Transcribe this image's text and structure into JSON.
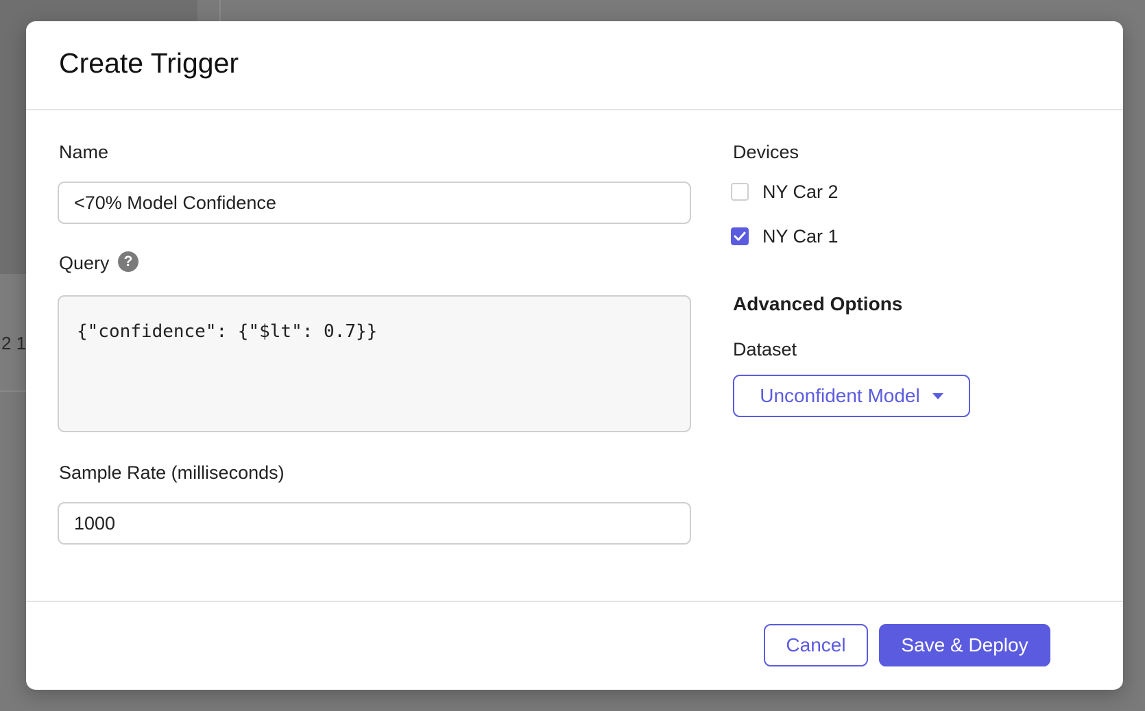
{
  "background": {
    "partial_text": "2 1"
  },
  "modal": {
    "title": "Create Trigger",
    "name_field": {
      "label": "Name",
      "value": "<70% Model Confidence"
    },
    "query_field": {
      "label": "Query",
      "help_glyph": "?",
      "value": "{\"confidence\": {\"$lt\": 0.7}}"
    },
    "sample_rate_field": {
      "label": "Sample Rate (milliseconds)",
      "value": "1000"
    },
    "devices": {
      "label": "Devices",
      "items": [
        {
          "label": "NY Car 2",
          "checked": false
        },
        {
          "label": "NY Car 1",
          "checked": true
        }
      ]
    },
    "advanced": {
      "heading": "Advanced Options",
      "dataset_label": "Dataset",
      "dataset_value": "Unconfident Model"
    },
    "footer": {
      "cancel_label": "Cancel",
      "save_label": "Save & Deploy"
    }
  },
  "colors": {
    "accent": "#5b5be0",
    "overlay": "#7a7a7a",
    "border": "#cfcfcf",
    "query_bg": "#f7f7f7"
  },
  "icons": {
    "help": "help-icon",
    "checkmark": "checkmark-icon",
    "dropdown": "caret-down-icon"
  }
}
